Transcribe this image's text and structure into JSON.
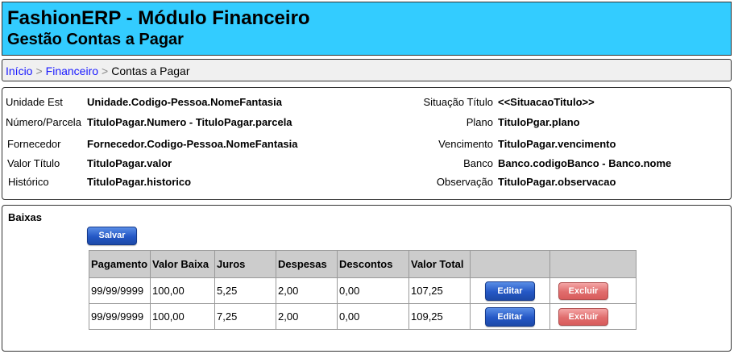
{
  "header": {
    "title": "FashionERP - Módulo Financeiro",
    "subtitle": "Gestão Contas a Pagar"
  },
  "breadcrumb": {
    "items": [
      "Início",
      "Financeiro",
      "Contas a Pagar"
    ],
    "separator": ">"
  },
  "info": {
    "left": [
      {
        "label": "Unidade Est",
        "value": "Unidade.Codigo-Pessoa.NomeFantasia"
      },
      {
        "label": "Número/Parcela",
        "value": "TituloPagar.Numero - TituloPagar.parcela"
      },
      {
        "label": "Fornecedor",
        "value": "Fornecedor.Codigo-Pessoa.NomeFantasia"
      },
      {
        "label": "Valor Título",
        "value": "TituloPagar.valor"
      },
      {
        "label": "Histórico",
        "value": "TituloPagar.historico"
      }
    ],
    "right": [
      {
        "label": "Situação Título",
        "value": "<<SituacaoTitulo>>"
      },
      {
        "label": "Plano",
        "value": "TituloPgar.plano"
      },
      {
        "label": "Vencimento",
        "value": "TituloPagar.vencimento"
      },
      {
        "label": "Banco",
        "value": "Banco.codigoBanco - Banco.nome"
      },
      {
        "label": "Observação",
        "value": "TituloPagar.observacao"
      }
    ]
  },
  "baixas": {
    "title": "Baixas",
    "save_label": "Salvar",
    "columns": [
      "Pagamento",
      "Valor Baixa",
      "Juros",
      "Despesas",
      "Descontos",
      "Valor Total",
      "",
      ""
    ],
    "rows": [
      {
        "pagamento": "99/99/9999",
        "valor_baixa": "100,00",
        "juros": "5,25",
        "despesas": "2,00",
        "descontos": "0,00",
        "valor_total": "107,25",
        "edit_label": "Editar",
        "delete_label": "Excluir"
      },
      {
        "pagamento": "99/99/9999",
        "valor_baixa": "100,00",
        "juros": "7,25",
        "despesas": "2,00",
        "descontos": "0,00",
        "valor_total": "109,25",
        "edit_label": "Editar",
        "delete_label": "Excluir"
      }
    ]
  },
  "colors": {
    "header_bg": "#33ccff",
    "link": "#1a1aff",
    "button_primary": "#2457c5",
    "button_danger": "#e06c6c",
    "table_header_bg": "#cccccc"
  }
}
